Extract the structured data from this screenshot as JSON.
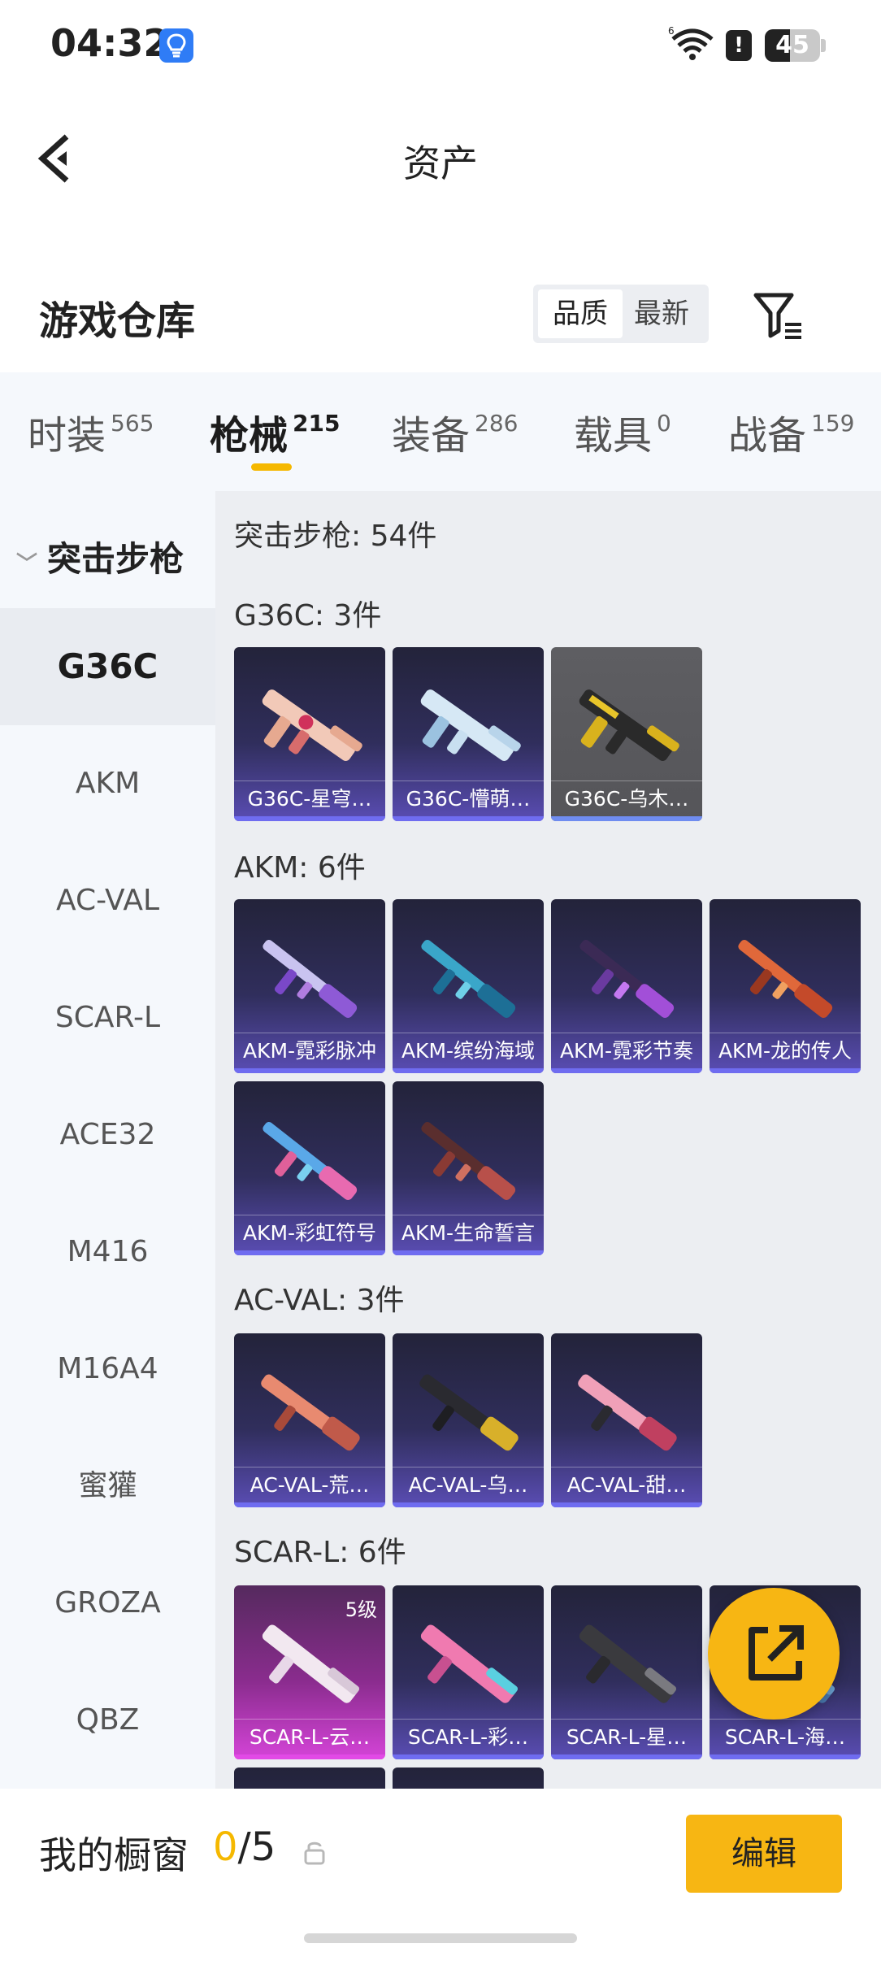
{
  "status": {
    "time": "04:32",
    "battery": "45",
    "battery_level": 0.45,
    "alert": "!"
  },
  "header": {
    "title": "资产"
  },
  "warehouse": {
    "title": "游戏仓库",
    "sort_quality": "品质",
    "sort_latest": "最新"
  },
  "categories": [
    {
      "label": "时装",
      "count": "565"
    },
    {
      "label": "枪械",
      "count": "215"
    },
    {
      "label": "装备",
      "count": "286"
    },
    {
      "label": "载具",
      "count": "0"
    },
    {
      "label": "战备",
      "count": "159"
    }
  ],
  "sidebar": {
    "header": "突击步枪",
    "items": [
      "G36C",
      "AKM",
      "AC-VAL",
      "SCAR-L",
      "ACE32",
      "M416",
      "M16A4",
      "蜜獾",
      "GROZA",
      "QBZ"
    ]
  },
  "content": {
    "total": "突击步枪: 54件",
    "groups": [
      {
        "title": "G36C: 3件",
        "items": [
          "G36C-星穹…",
          "G36C-懵萌…",
          "G36C-乌木…"
        ]
      },
      {
        "title": "AKM: 6件",
        "items": [
          "AKM-霓彩脉冲",
          "AKM-缤纷海域",
          "AKM-霓彩节奏",
          "AKM-龙的传人",
          "AKM-彩虹符号",
          "AKM-生命誓言"
        ]
      },
      {
        "title": "AC-VAL: 3件",
        "items": [
          "AC-VAL-荒…",
          "AC-VAL-乌…",
          "AC-VAL-甜…"
        ]
      },
      {
        "title": "SCAR-L: 6件",
        "items": [
          "SCAR-L-云…",
          "SCAR-L-彩…",
          "SCAR-L-星…",
          "SCAR-L-海…"
        ],
        "first_badge": "5级"
      }
    ]
  },
  "showcase": {
    "label": "我的橱窗",
    "current": "0",
    "max": "/5",
    "edit": "编辑"
  },
  "colors": {
    "accent": "#f5b800",
    "tile_purple": "#5a4db4",
    "tile_pink": "#d544d8"
  }
}
